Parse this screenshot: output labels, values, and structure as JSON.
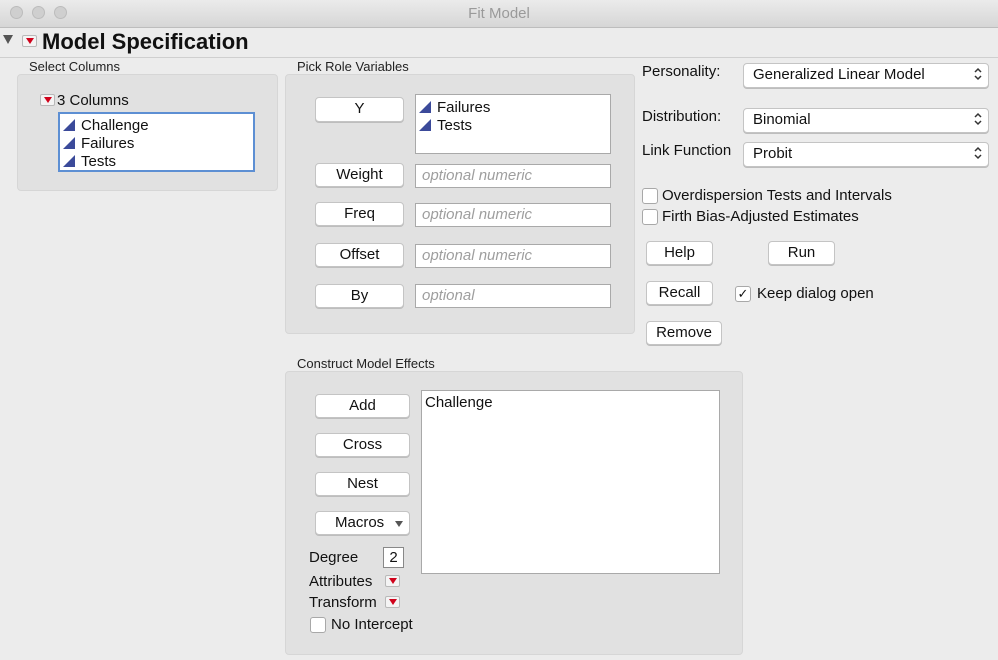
{
  "window": {
    "title": "Fit Model"
  },
  "header": {
    "title": "Model Specification"
  },
  "select_columns": {
    "label": "Select Columns",
    "group_label": "3 Columns",
    "items": [
      "Challenge",
      "Failures",
      "Tests"
    ]
  },
  "pick_roles": {
    "label": "Pick Role Variables",
    "y_label": "Y",
    "y_items": [
      "Failures",
      "Tests"
    ],
    "weight_label": "Weight",
    "weight_placeholder": "optional numeric",
    "freq_label": "Freq",
    "freq_placeholder": "optional numeric",
    "offset_label": "Offset",
    "offset_placeholder": "optional numeric",
    "by_label": "By",
    "by_placeholder": "optional"
  },
  "options": {
    "personality_label": "Personality:",
    "personality_value": "Generalized Linear Model",
    "distribution_label": "Distribution:",
    "distribution_value": "Binomial",
    "link_label": "Link Function",
    "link_value": "Probit",
    "overdispersion_label": "Overdispersion Tests and Intervals",
    "overdispersion_checked": false,
    "firth_label": "Firth Bias-Adjusted Estimates",
    "firth_checked": false,
    "help_label": "Help",
    "run_label": "Run",
    "recall_label": "Recall",
    "keep_open_label": "Keep dialog open",
    "keep_open_checked": true,
    "remove_label": "Remove"
  },
  "effects": {
    "label": "Construct Model Effects",
    "add_label": "Add",
    "cross_label": "Cross",
    "nest_label": "Nest",
    "macros_label": "Macros",
    "degree_label": "Degree",
    "degree_value": "2",
    "attributes_label": "Attributes",
    "transform_label": "Transform",
    "no_intercept_label": "No Intercept",
    "no_intercept_checked": false,
    "items": [
      "Challenge"
    ]
  },
  "colors": {
    "accent_red": "#d0021b",
    "column_icon": "#3b4a9a",
    "focus_blue": "#5d8fd3"
  }
}
